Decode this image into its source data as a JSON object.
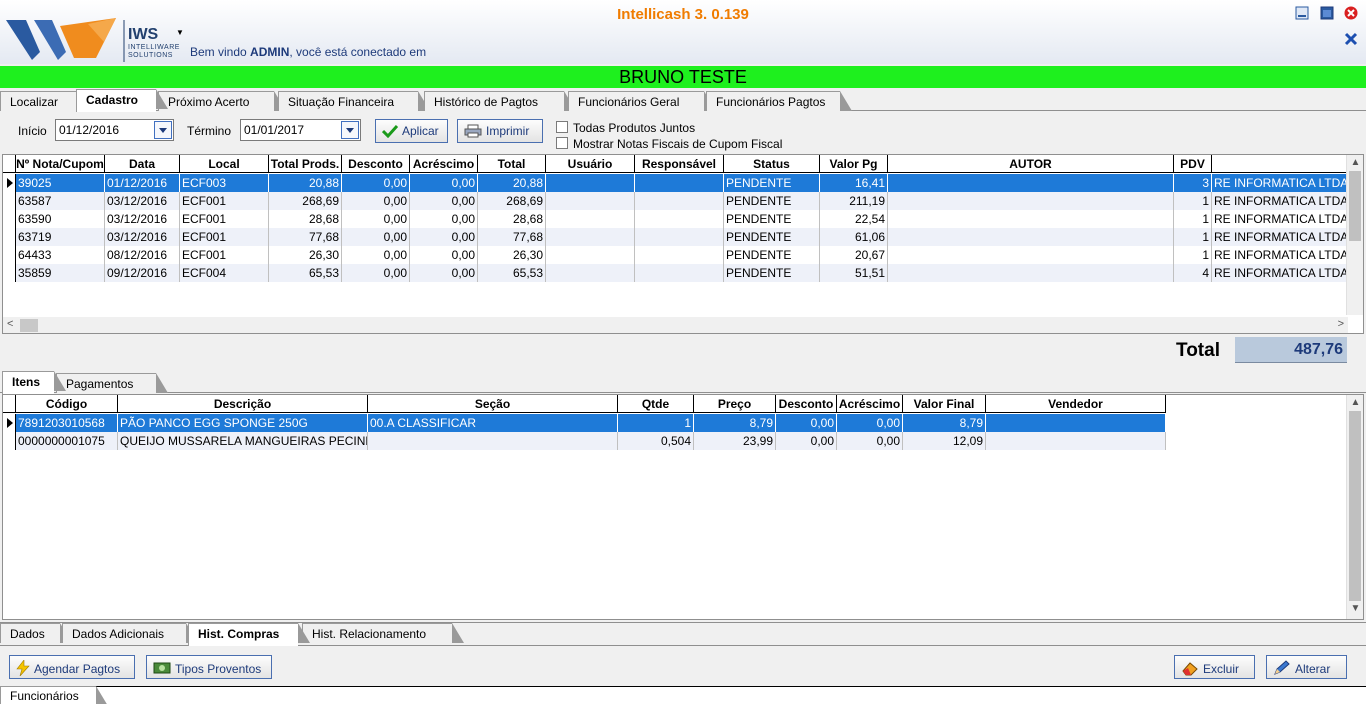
{
  "app": {
    "title": "Intellicash 3. 0.139",
    "logo_word": "IWS",
    "logo_sub1": "INTELLIWARE",
    "logo_sub2": "SOLUTIONS",
    "welcome_prefix": "Bem vindo ",
    "welcome_user": "ADMIN",
    "welcome_suffix": ", você está conectado em"
  },
  "customer_name": "BRUNO TESTE",
  "top_tabs": [
    "Localizar",
    "Cadastro",
    "Próximo Acerto",
    "Situação Financeira",
    "Histórico de Pagtos",
    "Funcionários Geral",
    "Funcionários Pagtos"
  ],
  "filters": {
    "start_label": "Início",
    "start_value": "01/12/2016",
    "end_label": "Término",
    "end_value": "01/01/2017",
    "apply_label": "Aplicar",
    "print_label": "Imprimir",
    "check_all_products": "Todas Produtos Juntos",
    "check_fiscal_notes": "Mostrar Notas Fiscais de Cupom Fiscal"
  },
  "notes_grid": {
    "columns": [
      "Nº Nota/Cupom",
      "Data",
      "Local",
      "Total Prods.",
      "Desconto",
      "Acréscimo",
      "Total",
      "Usuário",
      "Responsável",
      "Status",
      "Valor Pg",
      "AUTOR",
      "PDV",
      ""
    ],
    "rows": [
      [
        "39025",
        "01/12/2016",
        "ECF003",
        "20,88",
        "0,00",
        "0,00",
        "20,88",
        "",
        "",
        "PENDENTE",
        "16,41",
        "",
        "3",
        "RE INFORMATICA LTDA"
      ],
      [
        "63587",
        "03/12/2016",
        "ECF001",
        "268,69",
        "0,00",
        "0,00",
        "268,69",
        "",
        "",
        "PENDENTE",
        "211,19",
        "",
        "1",
        "RE INFORMATICA LTDA"
      ],
      [
        "63590",
        "03/12/2016",
        "ECF001",
        "28,68",
        "0,00",
        "0,00",
        "28,68",
        "",
        "",
        "PENDENTE",
        "22,54",
        "",
        "1",
        "RE INFORMATICA LTDA"
      ],
      [
        "63719",
        "03/12/2016",
        "ECF001",
        "77,68",
        "0,00",
        "0,00",
        "77,68",
        "",
        "",
        "PENDENTE",
        "61,06",
        "",
        "1",
        "RE INFORMATICA LTDA"
      ],
      [
        "64433",
        "08/12/2016",
        "ECF001",
        "26,30",
        "0,00",
        "0,00",
        "26,30",
        "",
        "",
        "PENDENTE",
        "20,67",
        "",
        "1",
        "RE INFORMATICA LTDA"
      ],
      [
        "35859",
        "09/12/2016",
        "ECF004",
        "65,53",
        "0,00",
        "0,00",
        "65,53",
        "",
        "",
        "PENDENTE",
        "51,51",
        "",
        "4",
        "RE INFORMATICA LTDA"
      ]
    ]
  },
  "total": {
    "label": "Total",
    "value": "487,76"
  },
  "detail_tabs": [
    "Itens",
    "Pagamentos"
  ],
  "items_grid": {
    "columns": [
      "Código",
      "Descrição",
      "Seção",
      "Qtde",
      "Preço",
      "Desconto",
      "Acréscimo",
      "Valor Final",
      "Vendedor"
    ],
    "rows": [
      [
        "7891203010568",
        "PÃO PANCO EGG SPONGE 250G",
        "00.A CLASSIFICAR",
        "1",
        "8,79",
        "0,00",
        "0,00",
        "8,79",
        ""
      ],
      [
        "0000000001075",
        "QUEIJO MUSSARELA MANGUEIRAS PECINHA",
        "",
        "0,504",
        "23,99",
        "0,00",
        "0,00",
        "12,09",
        ""
      ]
    ]
  },
  "bottom_tabs": [
    "Dados",
    "Dados Adicionais",
    "Hist. Compras",
    "Hist. Relacionamento"
  ],
  "actions": {
    "schedule_label": "Agendar Pagtos",
    "earnings_label": "Tipos Proventos",
    "delete_label": "Excluir",
    "edit_label": "Alterar"
  },
  "status_tab": "Funcionários"
}
